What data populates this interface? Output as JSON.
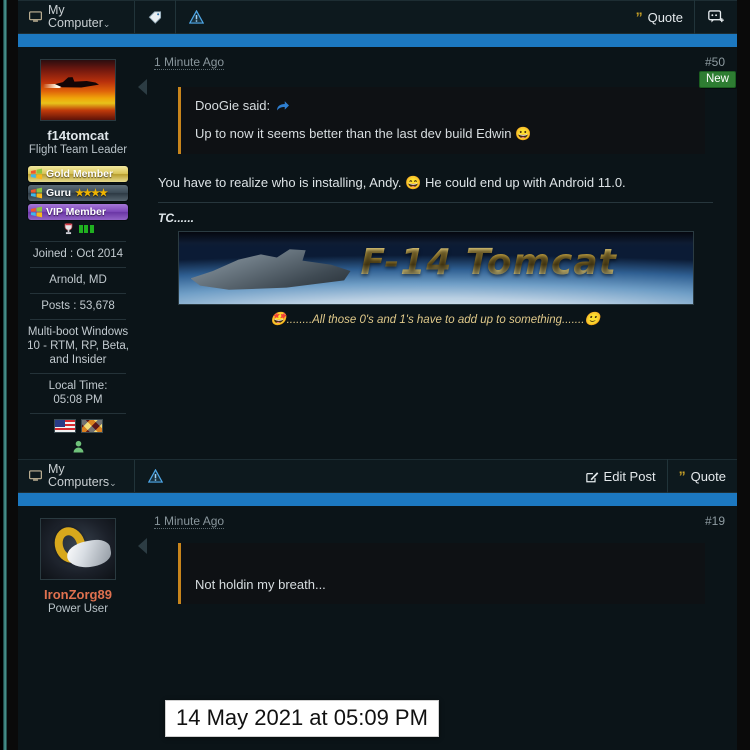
{
  "theme": {
    "accent_blue": "#1c78c0",
    "page_bg": "#0b1418",
    "toolbar_bg": "#0d191e",
    "quote_border": "#c8851c",
    "new_badge_bg": "#2e7d32",
    "link_blue": "#3e9fe0",
    "left_rail_teal": "#4d9b95"
  },
  "post1": {
    "toolbar": {
      "my_computer_label": "My Computer",
      "my_computer_caret": "⌄",
      "monitor_icon": "monitor-icon",
      "tag_icon": "tag-icon",
      "warning_icon": "warning-triangle-icon",
      "quote_label": "Quote",
      "quote_mark": "”",
      "multiquote_icon": "multi-quote-icon"
    },
    "user": {
      "avatar_icon": "f14-tomcat-sunset-avatar",
      "username": "f14tomcat",
      "title": "Flight Team Leader",
      "badges": [
        {
          "label": "Gold Member",
          "style": "gold",
          "stars": ""
        },
        {
          "label": "Guru",
          "style": "guru",
          "stars": "★★★★"
        },
        {
          "label": "VIP Member",
          "style": "vip",
          "stars": ""
        }
      ],
      "rank_icon": "trophy-icon",
      "rank_bars_icon": "rank-bars-icon",
      "joined": "Joined : Oct 2014",
      "location": "Arnold, MD",
      "posts": "Posts : 53,678",
      "system": "Multi-boot Windows 10 - RTM, RP, Beta, and Insider",
      "local_time_label": "Local Time:",
      "local_time": "05:08 PM",
      "flag_us_icon": "us-flag-icon",
      "flag_md_icon": "maryland-flag-icon",
      "online_icon": "online-user-icon"
    },
    "date": "1 Minute Ago",
    "number": "#50",
    "new_badge": "New",
    "quote": {
      "attribution": "DooGie said:",
      "jump_icon": "jump-to-post-icon",
      "body": "Up to now it seems better than the last dev build Edwin",
      "body_emoji": "😀"
    },
    "body_part1": "You have to realize who is installing, Andy.",
    "body_emoji": "😄",
    "body_part2": "He could end up with Android 11.0.",
    "signature": {
      "label": "TC......",
      "banner_text": "F-14 Tomcat",
      "banner_icon": "f14-tomcat-banner-image",
      "caption_emoji_left": "🤩",
      "caption": "........All those 0's and 1's have to add up to something.......",
      "caption_emoji_right": "🙂"
    }
  },
  "post2": {
    "toolbar": {
      "my_computer_label": "My Computers",
      "my_computer_caret": "⌄",
      "monitor_icon": "monitor-icon",
      "warning_icon": "warning-triangle-icon",
      "edit_post_label": "Edit Post",
      "edit_icon": "edit-pencil-icon",
      "quote_label": "Quote",
      "quote_mark": "”"
    },
    "user": {
      "avatar_icon": "gold-ring-avatar",
      "username": "IronZorg89",
      "title": "Power User"
    },
    "date": "1 Minute Ago",
    "number": "#19",
    "body": "Not holdin my breath..."
  },
  "tooltip": {
    "date_tooltip": "14 May 2021 at 05:09 PM"
  }
}
